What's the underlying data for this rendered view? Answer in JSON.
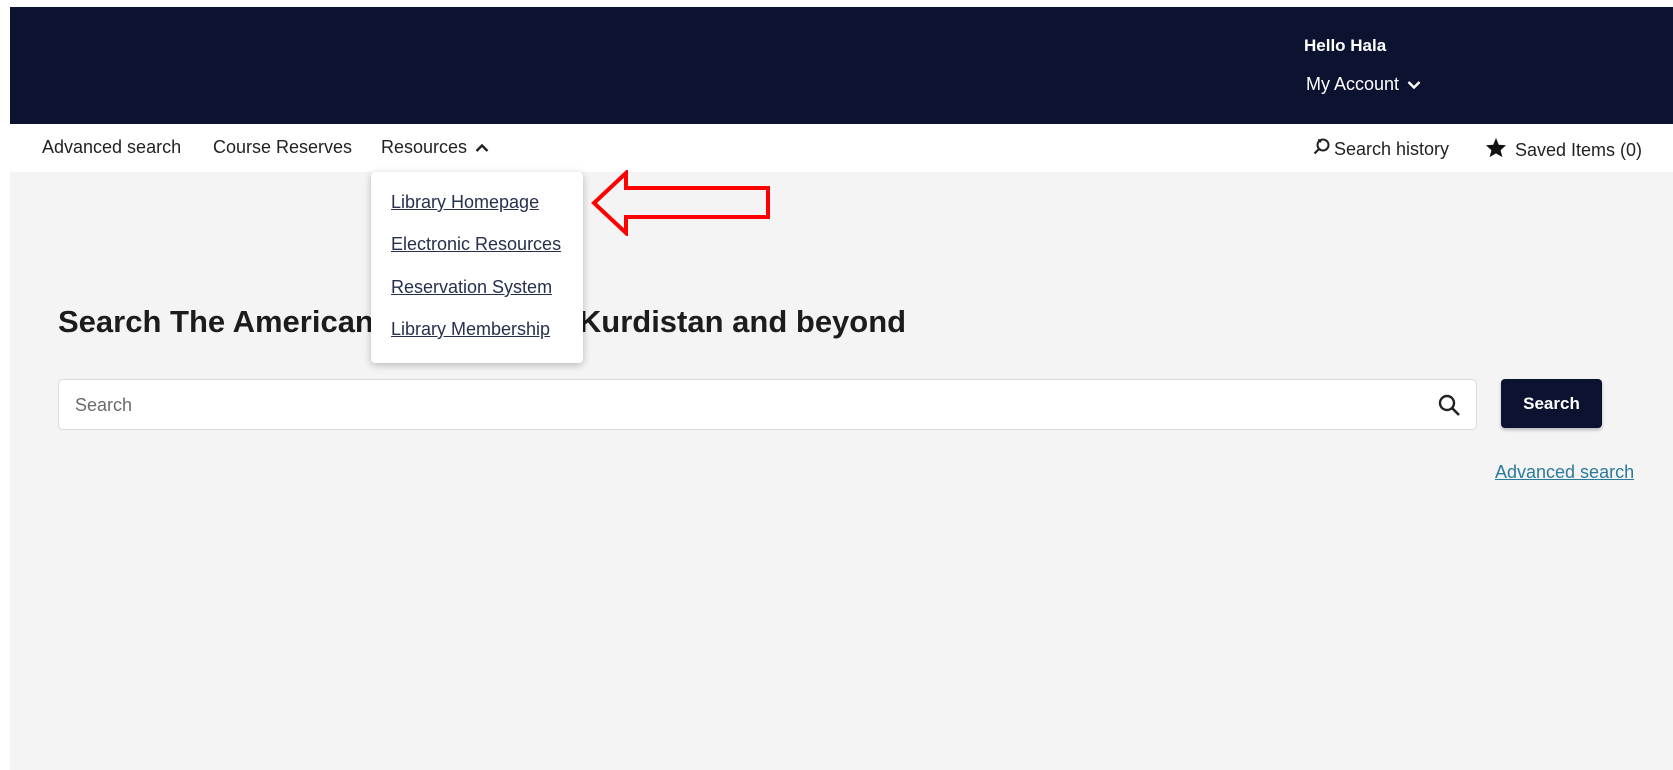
{
  "header": {
    "greeting": "Hello Hala",
    "account_label": "My Account",
    "background_color": "#0b1331"
  },
  "nav": {
    "advanced_search": "Advanced search",
    "course_reserves": "Course Reserves",
    "resources": "Resources",
    "search_history": "Search history",
    "saved_items": "Saved Items (0)"
  },
  "resources_menu": {
    "items": [
      {
        "label": "Library Homepage"
      },
      {
        "label": "Electronic Resources"
      },
      {
        "label": "Reservation System"
      },
      {
        "label": "Library Membership"
      }
    ]
  },
  "main": {
    "headline": "Search The American University of Kurdistan and beyond",
    "search_placeholder": "Search",
    "search_button": "Search",
    "advanced_search_link": "Advanced search"
  },
  "icons": {
    "account_chevron": "chevron-down-icon",
    "resources_chevron": "chevron-up-icon",
    "search_history": "history-search-icon",
    "saved_items": "star-icon",
    "search": "search-icon",
    "annotation": "left-arrow-annotation"
  },
  "colors": {
    "accent": "#0b1331",
    "link": "#2b7a9a",
    "annotation": "#ff0000"
  }
}
